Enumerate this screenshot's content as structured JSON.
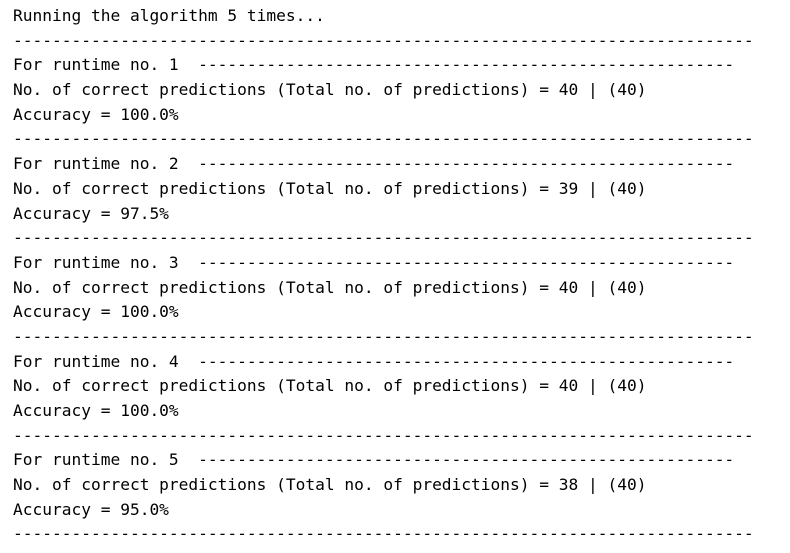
{
  "console": {
    "intro": "Running the algorithm 5 times...",
    "separator": "----------------------------------------------------------------------------",
    "runs": [
      {
        "header": "For runtime no. 1  -------------------------------------------------------",
        "correct": "No. of correct predictions (Total no. of predictions) = 40 | (40)",
        "accuracy": "Accuracy = 100.0%"
      },
      {
        "header": "For runtime no. 2  -------------------------------------------------------",
        "correct": "No. of correct predictions (Total no. of predictions) = 39 | (40)",
        "accuracy": "Accuracy = 97.5%"
      },
      {
        "header": "For runtime no. 3  -------------------------------------------------------",
        "correct": "No. of correct predictions (Total no. of predictions) = 40 | (40)",
        "accuracy": "Accuracy = 100.0%"
      },
      {
        "header": "For runtime no. 4  -------------------------------------------------------",
        "correct": "No. of correct predictions (Total no. of predictions) = 40 | (40)",
        "accuracy": "Accuracy = 100.0%"
      },
      {
        "header": "For runtime no. 5  -------------------------------------------------------",
        "correct": "No. of correct predictions (Total no. of predictions) = 38 | (40)",
        "accuracy": "Accuracy = 95.0%"
      }
    ]
  }
}
